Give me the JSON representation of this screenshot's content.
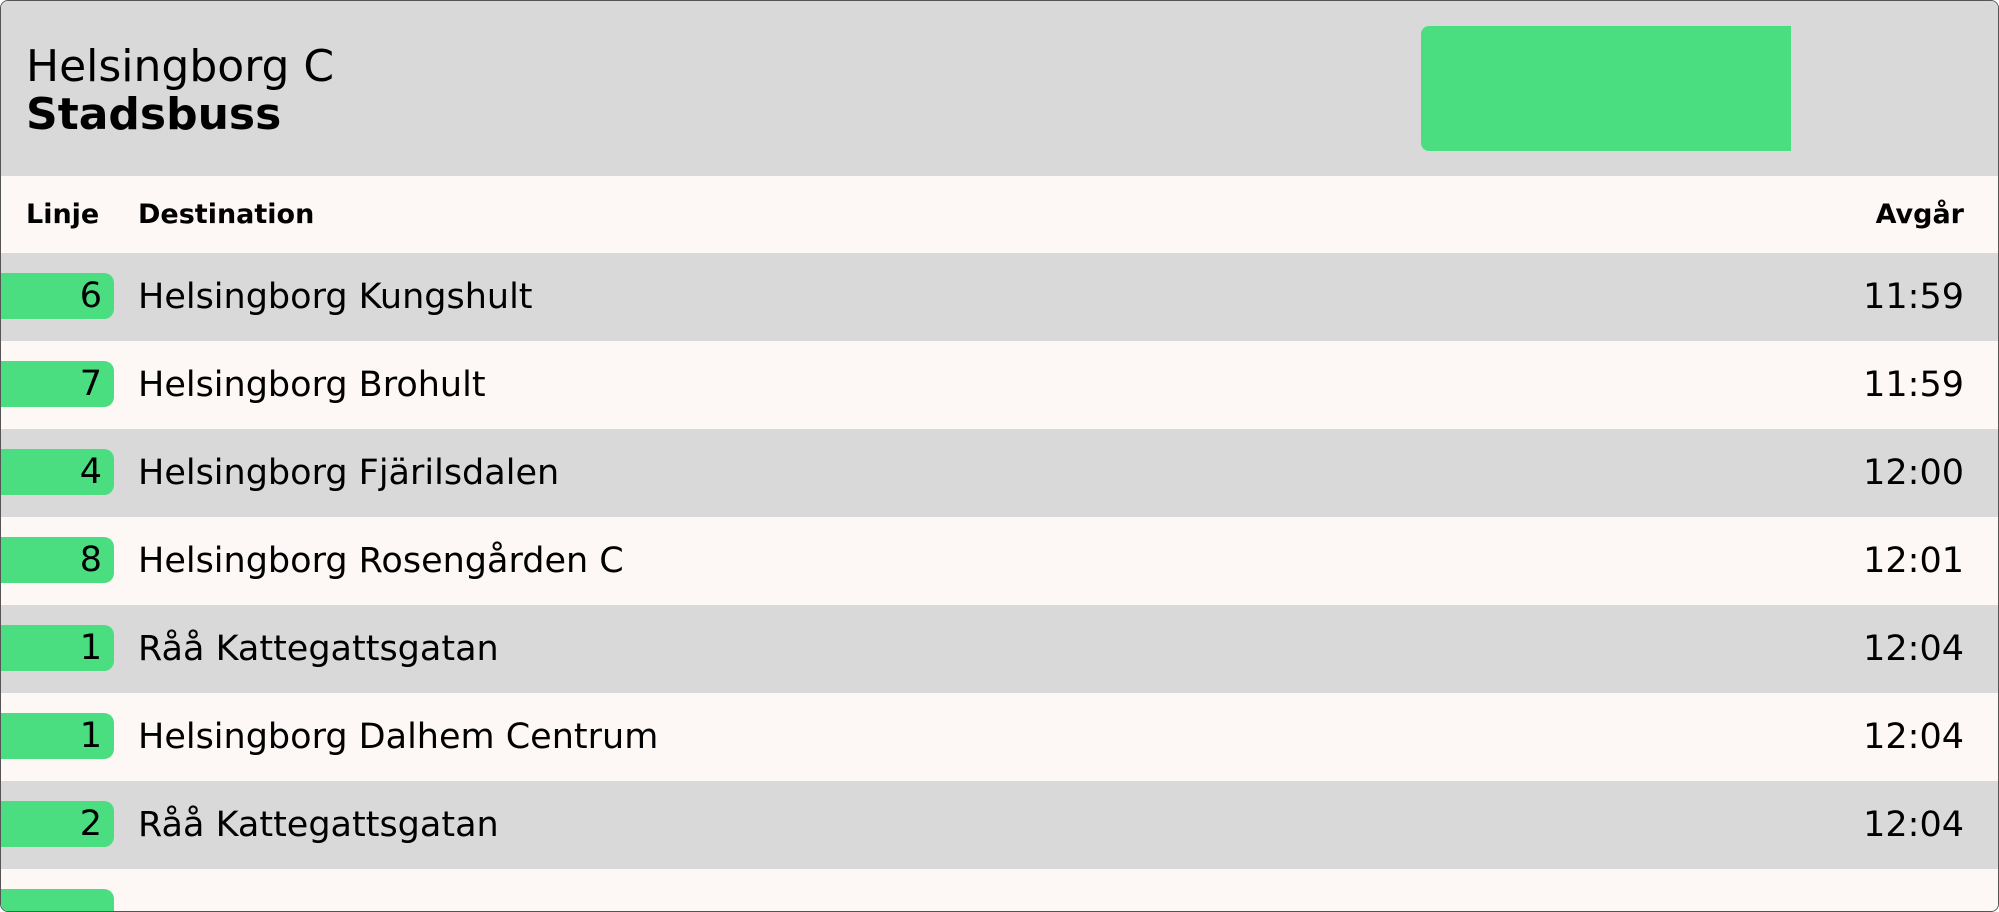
{
  "header": {
    "station": "Helsingborg C",
    "category": "Stadsbuss",
    "accent_color": "#4ade80",
    "background_color": "#d9d9d9"
  },
  "columns": {
    "line": "Linje",
    "destination": "Destination",
    "departure": "Avgår"
  },
  "departures": [
    {
      "line": "6",
      "destination": "Helsingborg Kungshult",
      "time": "11:59"
    },
    {
      "line": "7",
      "destination": "Helsingborg Brohult",
      "time": "11:59"
    },
    {
      "line": "4",
      "destination": "Helsingborg Fjärilsdalen",
      "time": "12:00"
    },
    {
      "line": "8",
      "destination": "Helsingborg Rosengården C",
      "time": "12:01"
    },
    {
      "line": "1",
      "destination": "Råå Kattegattsgatan",
      "time": "12:04"
    },
    {
      "line": "1",
      "destination": "Helsingborg Dalhem Centrum",
      "time": "12:04"
    },
    {
      "line": "2",
      "destination": "Råå Kattegattsgatan",
      "time": "12:04"
    },
    {
      "line": "",
      "destination": "",
      "time": ""
    }
  ]
}
